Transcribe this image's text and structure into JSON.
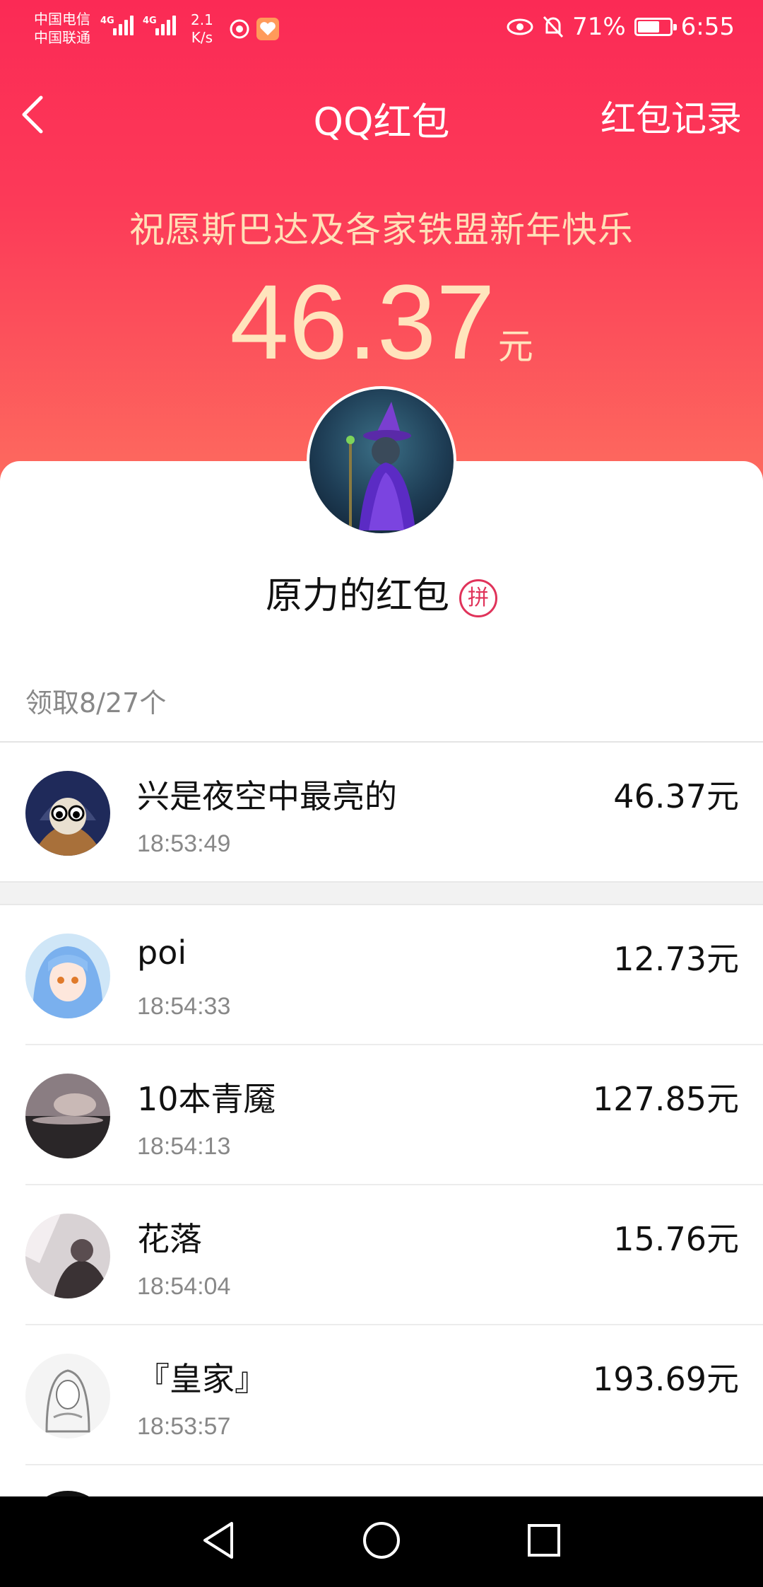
{
  "status_bar": {
    "carrier_1": "中国电信",
    "carrier_2": "中国联通",
    "net_tag_1": "4G",
    "net_tag_2": "4G",
    "speed_value": "2.1",
    "speed_unit": "K/s",
    "battery": "71%",
    "battery_level": 0.71,
    "time": "6:55",
    "icons": [
      "eye-icon",
      "bell-off-icon",
      "battery-icon"
    ]
  },
  "nav": {
    "back_icon": "chevron-left-icon",
    "title": "QQ红包",
    "record": "红包记录"
  },
  "hero": {
    "wish": "祝愿斯巴达及各家铁盟新年快乐",
    "amount": "46.37",
    "unit": "元"
  },
  "sender": {
    "name": "原力的红包",
    "badge": "拼"
  },
  "claimed": "领取8/27个",
  "records": [
    {
      "name": "兴是夜空中最亮的",
      "time": "18:53:49",
      "amount": "46.37元"
    },
    {
      "name": "poi",
      "time": "18:54:33",
      "amount": "12.73元"
    },
    {
      "name": "10本青魇",
      "time": "18:54:13",
      "amount": "127.85元"
    },
    {
      "name": "花落",
      "time": "18:54:04",
      "amount": "15.76元"
    },
    {
      "name": "『皇家』",
      "time": "18:53:57",
      "amount": "193.69元"
    }
  ],
  "colors": {
    "header_top": "#fb2a55",
    "header_bottom": "#fd6f5f",
    "gold_text": "#ffe4bd",
    "badge": "#e0335a"
  },
  "system_nav": [
    "back-triangle-icon",
    "home-circle-icon",
    "recents-square-icon"
  ]
}
